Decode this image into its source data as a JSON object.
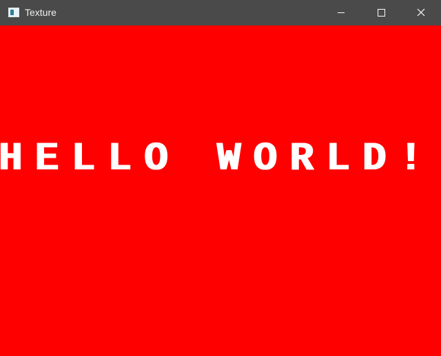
{
  "window": {
    "title": "Texture",
    "icon": "app-window-icon",
    "controls": {
      "minimize_icon": "minimize-icon",
      "maximize_icon": "maximize-icon",
      "close_icon": "close-icon"
    },
    "colors": {
      "titlebar": "#4a4a4a",
      "title_text": "#f3f3f3"
    }
  },
  "canvas": {
    "text": "HELLO WORLD!",
    "colors": {
      "background": "#ff0000",
      "text": "#ffffff"
    }
  }
}
